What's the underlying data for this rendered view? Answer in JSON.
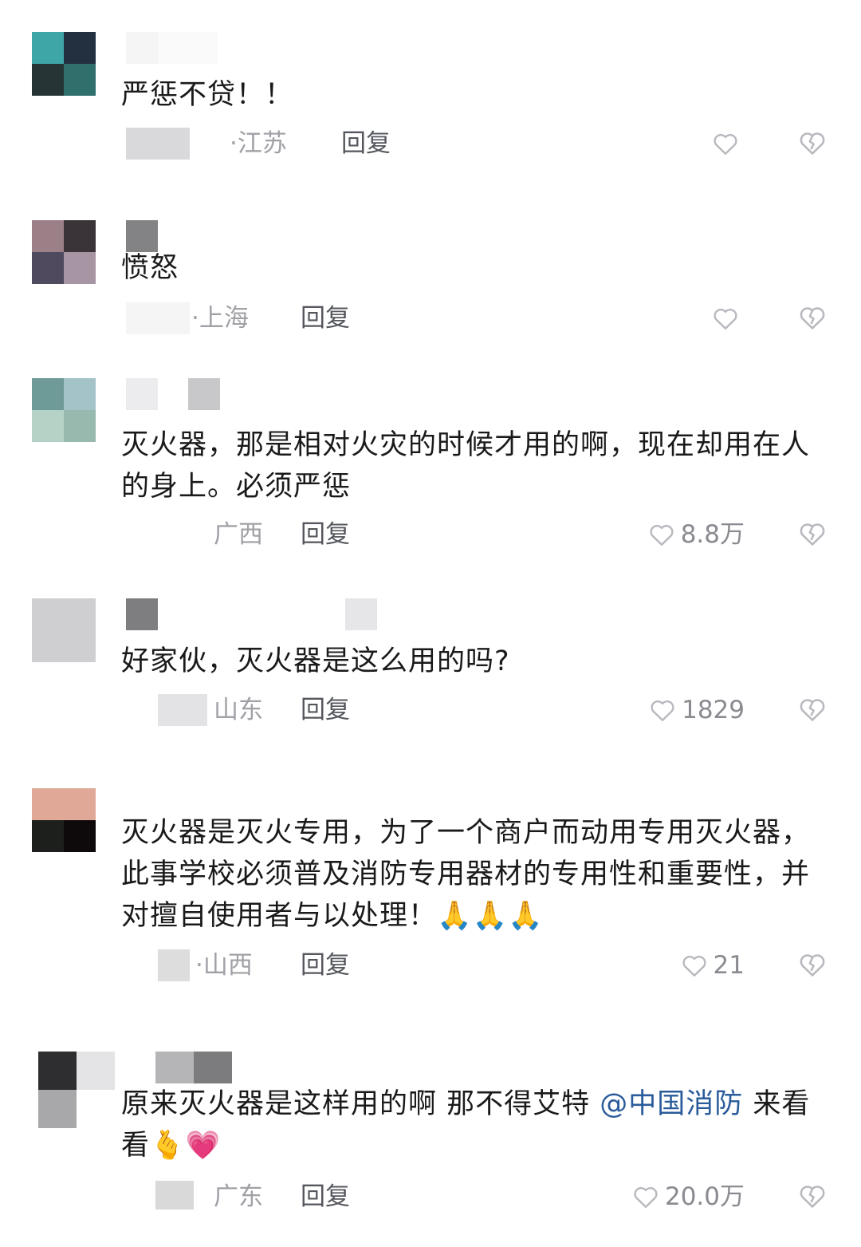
{
  "comments": [
    {
      "text": "严惩不贷！！",
      "location": "·江苏",
      "reply_label": "回复",
      "like_count": "",
      "avatar_colors": [
        "#3fa6a8",
        "#23303f",
        "#273435",
        "#2f6f6c"
      ]
    },
    {
      "text": "愤怒",
      "location": "·上海",
      "reply_label": "回复",
      "like_count": "",
      "avatar_colors": [
        "#9c8088",
        "#3a3439",
        "#4f4a5d",
        "#a895a3"
      ]
    },
    {
      "text": "灭火器，那是相对火灾的时候才用的啊，现在却用在人的身上。必须严惩",
      "location": "广西",
      "reply_label": "回复",
      "like_count": "8.8万",
      "avatar_colors": [
        "#6e9a97",
        "#a3c3c8",
        "#b6d2c7",
        "#98b9ad"
      ]
    },
    {
      "text": "好家伙，灭火器是这么用的吗?",
      "location": "山东",
      "reply_label": "回复",
      "like_count": "1829",
      "avatar_colors": [
        "#cfcfd1",
        "#cfcfd1",
        "#cfcfd1",
        "#cfcfd1"
      ]
    },
    {
      "text": "灭火器是灭火专用，为了一个商户而动用专用灭火器，此事学校必须普及消防专用器材的专用性和重要性，并对擅自使用者与以处理！",
      "emoji": "🙏🙏🙏",
      "location": "·山西",
      "reply_label": "回复",
      "like_count": "21",
      "avatar_colors": [
        "#e0a896",
        "#e0a896",
        "#1c1f1c",
        "#0e0a0b"
      ]
    },
    {
      "text": "原来灭火器是这样用的啊 那不得艾特",
      "mention": "@中国消防",
      "text_after": " 来看看",
      "emoji": "🫰💗",
      "location": "广东",
      "reply_label": "回复",
      "like_count": "20.0万",
      "avatar_colors": [
        "#2e2e30",
        "#e4e4e6",
        "#a8a8aa",
        "#ffffff"
      ]
    }
  ],
  "colors": {
    "text": "#1a1a1a",
    "secondary": "#a0a0a6",
    "reply": "#55575e",
    "mention": "#2a5b9b",
    "icon": "#b8b9be"
  }
}
